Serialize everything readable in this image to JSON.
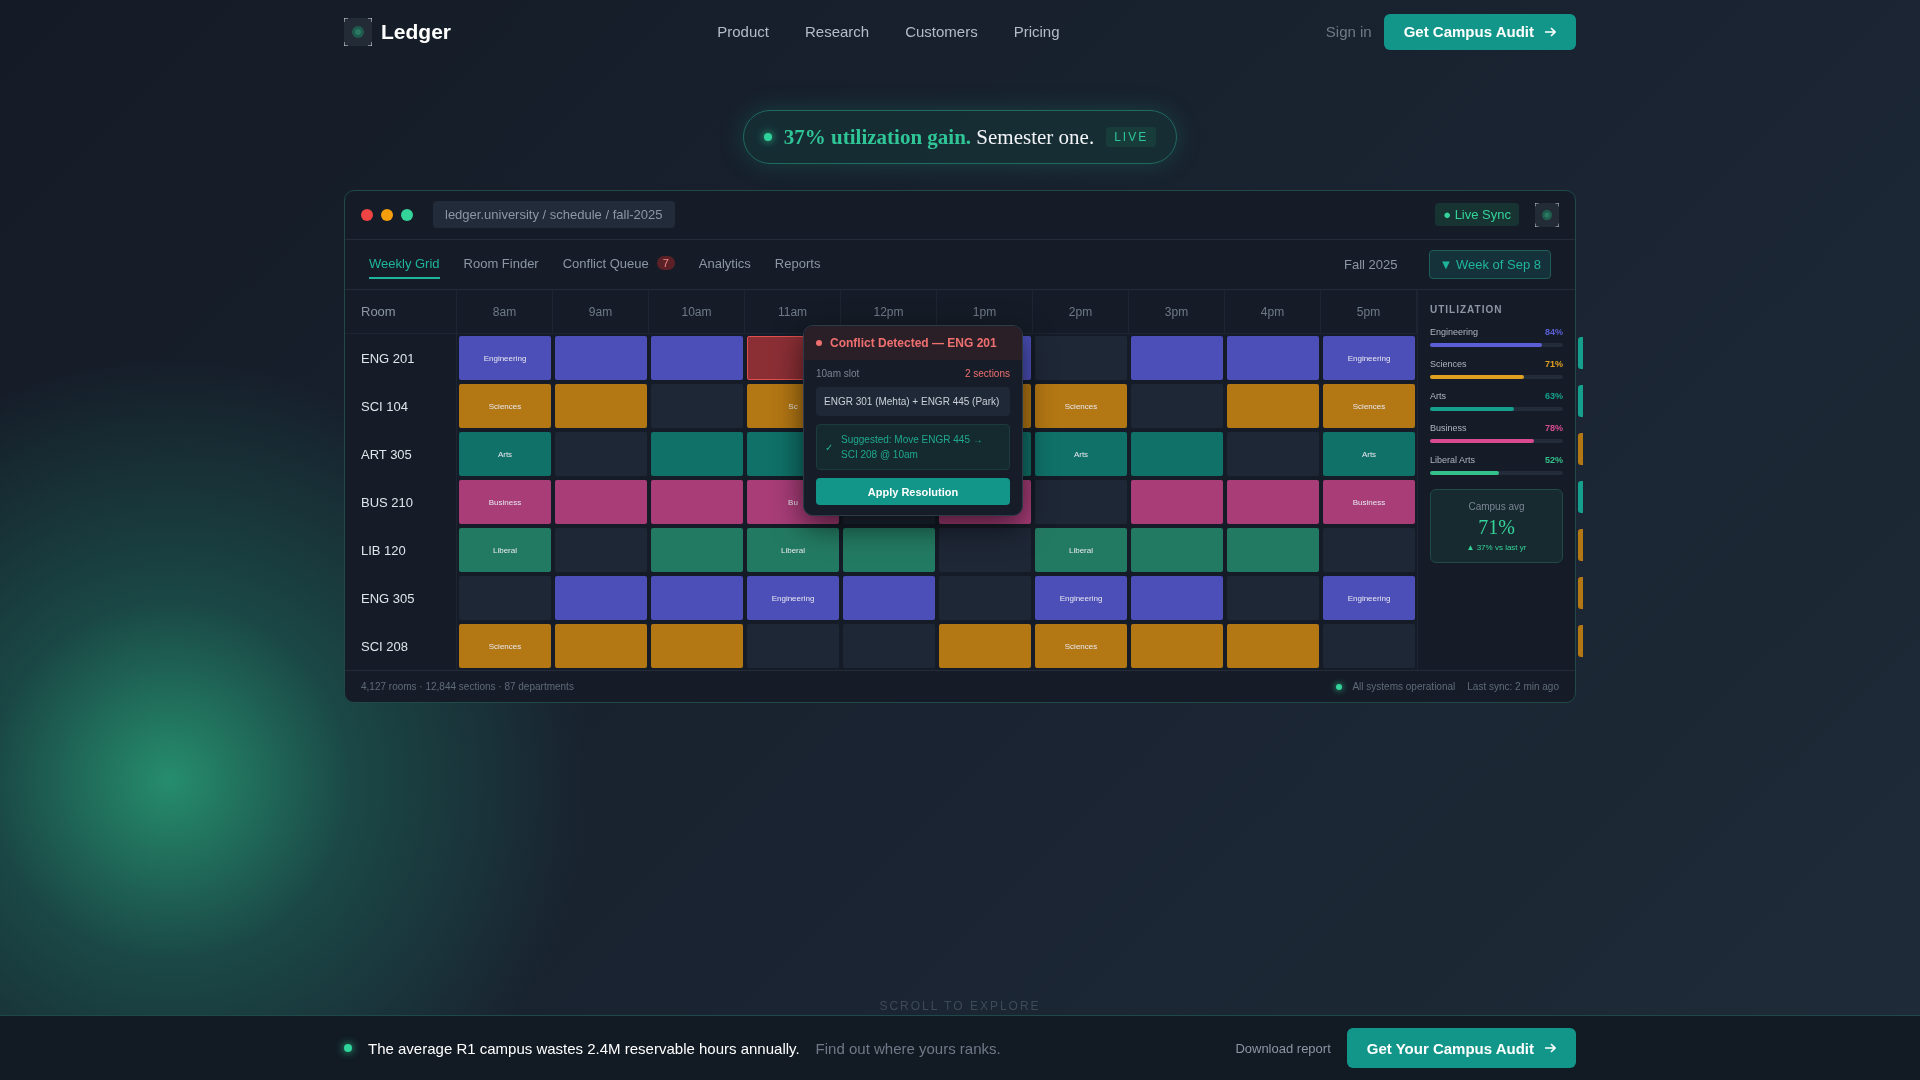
{
  "nav": {
    "brand": "Ledger",
    "links": [
      "Product",
      "Research",
      "Customers",
      "Pricing"
    ],
    "sign_in": "Sign in",
    "cta": "Get Campus Audit"
  },
  "headline_badge": {
    "text": "**37% utilization gain.** Semester one.",
    "tag": "LIVE"
  },
  "app_window": {
    "address": "ledger.university / schedule / fall-2025",
    "live_sync": "● Live Sync",
    "tabs": [
      {
        "label": "Weekly Grid",
        "selected": true
      },
      {
        "label": "Room Finder",
        "selected": false
      },
      {
        "label": "Conflict Queue",
        "selected": false,
        "count": "7"
      },
      {
        "label": "Analytics",
        "selected": false
      },
      {
        "label": "Reports",
        "selected": false
      }
    ],
    "term": "Fall 2025",
    "week_filter": "▼ Week of Sep 8",
    "grid": {
      "room_heading": "Room",
      "hours": [
        "8am",
        "9am",
        "10am",
        "11am",
        "12pm",
        "1pm",
        "2pm",
        "3pm",
        "4pm",
        "5pm"
      ],
      "rows": [
        {
          "room": "ENG 201",
          "cells": [
            {
              "kind": "eng",
              "label": "Engineering"
            },
            {
              "kind": "eng"
            },
            {
              "kind": "eng"
            },
            {
              "kind": "conflict"
            },
            null,
            {
              "kind": "eng"
            },
            {
              "kind": "empty"
            },
            {
              "kind": "eng"
            },
            {
              "kind": "eng"
            },
            {
              "kind": "eng",
              "label": "Engineering"
            }
          ]
        },
        {
          "room": "SCI 104",
          "cells": [
            {
              "kind": "sci",
              "label": "Sciences"
            },
            {
              "kind": "sci"
            },
            {
              "kind": "empty"
            },
            {
              "kind": "sci",
              "label": "Sc"
            },
            null,
            {
              "kind": "sci"
            },
            {
              "kind": "sci",
              "label": "Sciences"
            },
            {
              "kind": "empty"
            },
            {
              "kind": "sci"
            },
            {
              "kind": "sci",
              "label": "Sciences"
            }
          ]
        },
        {
          "room": "ART 305",
          "cells": [
            {
              "kind": "arts",
              "label": "Arts"
            },
            {
              "kind": "empty"
            },
            {
              "kind": "arts"
            },
            {
              "kind": "arts"
            },
            null,
            {
              "kind": "arts"
            },
            {
              "kind": "arts",
              "label": "Arts"
            },
            {
              "kind": "arts"
            },
            {
              "kind": "empty"
            },
            {
              "kind": "arts",
              "label": "Arts"
            }
          ]
        },
        {
          "room": "BUS 210",
          "cells": [
            {
              "kind": "bus",
              "label": "Business"
            },
            {
              "kind": "bus"
            },
            {
              "kind": "bus"
            },
            {
              "kind": "bus",
              "label": "Bu"
            },
            {
              "kind": "empty"
            },
            {
              "kind": "bus"
            },
            {
              "kind": "empty"
            },
            {
              "kind": "bus"
            },
            {
              "kind": "bus"
            },
            {
              "kind": "bus",
              "label": "Business"
            }
          ]
        },
        {
          "room": "LIB 120",
          "cells": [
            {
              "kind": "lib",
              "label": "Liberal"
            },
            {
              "kind": "empty"
            },
            {
              "kind": "lib"
            },
            {
              "kind": "lib",
              "label": "Liberal"
            },
            {
              "kind": "lib"
            },
            {
              "kind": "empty"
            },
            {
              "kind": "lib",
              "label": "Liberal"
            },
            {
              "kind": "lib"
            },
            {
              "kind": "lib"
            },
            {
              "kind": "empty"
            }
          ]
        },
        {
          "room": "ENG 305",
          "cells": [
            {
              "kind": "empty"
            },
            {
              "kind": "eng"
            },
            {
              "kind": "eng"
            },
            {
              "kind": "eng",
              "label": "Engineering"
            },
            {
              "kind": "eng"
            },
            {
              "kind": "empty"
            },
            {
              "kind": "eng",
              "label": "Engineering"
            },
            {
              "kind": "eng"
            },
            {
              "kind": "empty"
            },
            {
              "kind": "eng",
              "label": "Engineering"
            }
          ]
        },
        {
          "room": "SCI 208",
          "cells": [
            {
              "kind": "sci",
              "label": "Sciences"
            },
            {
              "kind": "sci"
            },
            {
              "kind": "sci"
            },
            {
              "kind": "empty"
            },
            {
              "kind": "empty"
            },
            {
              "kind": "sci"
            },
            {
              "kind": "sci",
              "label": "Sciences"
            },
            {
              "kind": "sci"
            },
            {
              "kind": "sci"
            },
            {
              "kind": "empty"
            }
          ]
        }
      ]
    },
    "conflict_popup": {
      "title": "Conflict Detected — ENG 201",
      "slot": "10am slot",
      "count": "2 sections",
      "sections": "ENGR 301 (Mehta) + ENGR 445 (Park)",
      "check": "✓",
      "suggestion": "Suggested: Move ENGR 445 → SCI 208 @ 10am",
      "action": "Apply Resolution"
    },
    "utilization": {
      "heading": "UTILIZATION",
      "items": [
        {
          "name": "Engineering",
          "value": "84%",
          "level": 0.84,
          "color": "#5b5fd6"
        },
        {
          "name": "Sciences",
          "value": "71%",
          "level": 0.71,
          "color": "#e0a020"
        },
        {
          "name": "Arts",
          "value": "63%",
          "level": 0.63,
          "color": "#14a08c"
        },
        {
          "name": "Business",
          "value": "78%",
          "level": 0.78,
          "color": "#d94a90"
        },
        {
          "name": "Liberal Arts",
          "value": "52%",
          "level": 0.52,
          "color": "#34c08a"
        }
      ],
      "campus_avg": {
        "label": "Campus avg",
        "value": "71%",
        "change": "▲ 37% vs last yr"
      }
    },
    "edge_tabs": [
      {
        "color": "#14a08c"
      },
      {
        "color": "#14a08c"
      },
      {
        "color": "#b37714"
      },
      {
        "color": "#14a08c"
      },
      {
        "color": "#b37714"
      },
      {
        "color": "#b37714"
      },
      {
        "color": "#b37714"
      }
    ],
    "footer": {
      "stats": "4,127 rooms · 12,844 sections · 87 departments",
      "status": "All systems operational",
      "last_sync": "Last sync: 2 min ago"
    }
  },
  "scroll_hint": "SCROLL TO EXPLORE",
  "bottom_bar": {
    "statement": "The average R1 campus wastes 2.4M reservable hours annually.",
    "prompt": "Find out where yours ranks.",
    "download": "Download report",
    "cta": "Get Your Campus Audit"
  }
}
